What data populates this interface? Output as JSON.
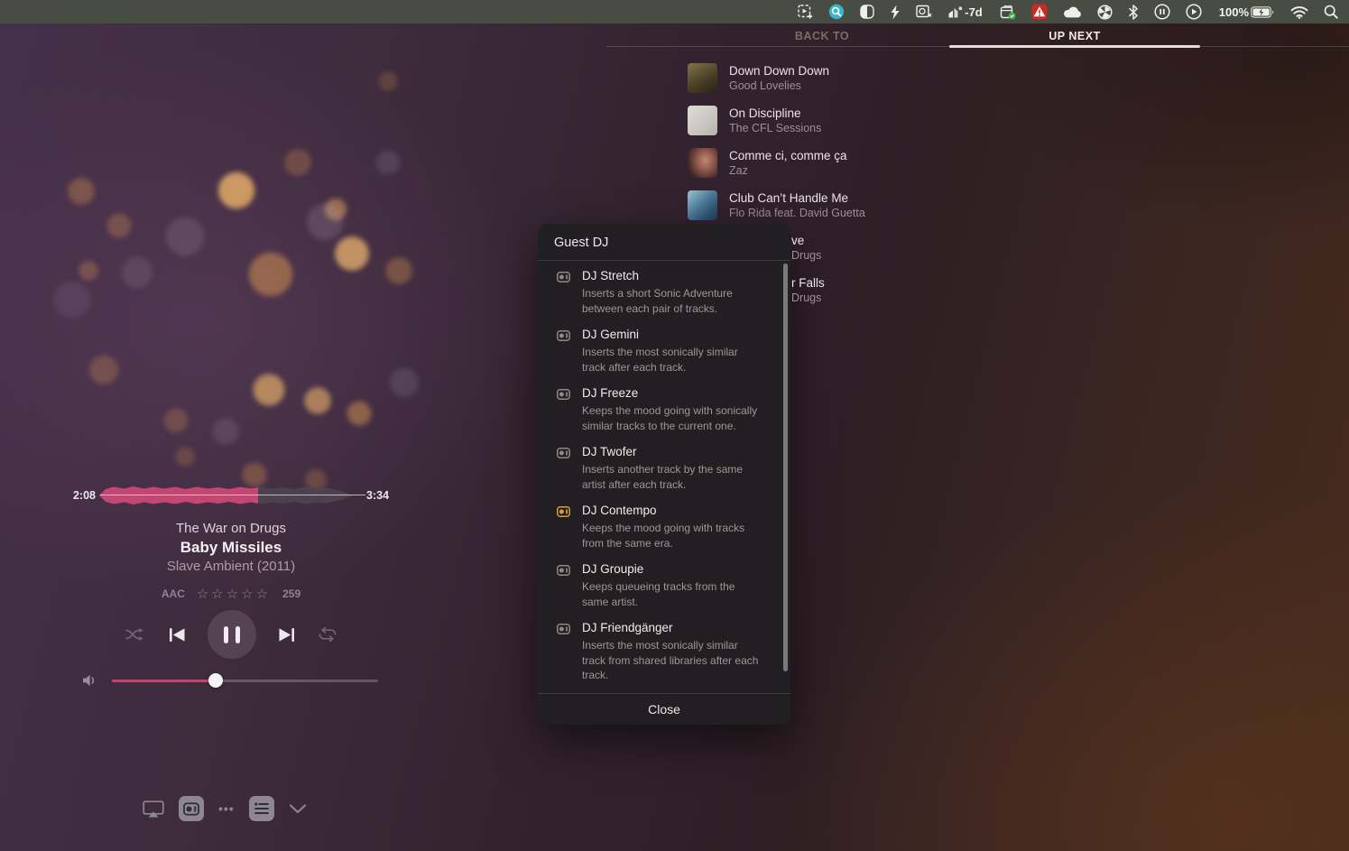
{
  "menu_bar": {
    "bg": "#474d42",
    "items": [
      {
        "name": "screen-capture"
      },
      {
        "name": "search-app"
      },
      {
        "name": "display-contrast"
      },
      {
        "name": "lightning"
      },
      {
        "name": "photo-ocr"
      },
      {
        "name": "data-meter",
        "label": "-7d"
      },
      {
        "name": "package-status"
      },
      {
        "name": "warning-alert"
      },
      {
        "name": "cloud"
      },
      {
        "name": "activity-pie"
      },
      {
        "name": "bluetooth"
      },
      {
        "name": "record-circle"
      },
      {
        "name": "play-circle"
      },
      {
        "name": "battery",
        "label": "100%"
      },
      {
        "name": "wifi"
      },
      {
        "name": "spotlight-search"
      }
    ]
  },
  "tabs": {
    "back_to": "BACK TO",
    "up_next": "UP NEXT",
    "active": "UP NEXT"
  },
  "up_next": {
    "items": [
      {
        "title": "Down Down Down",
        "artist": "Good Lovelies"
      },
      {
        "title": "On Discipline",
        "artist": "The CFL Sessions"
      },
      {
        "title": "Comme ci, comme ça",
        "artist": "Zaz"
      },
      {
        "title": "Club Can’t Handle Me",
        "artist": "Flo Rida feat. David Guetta"
      }
    ],
    "partial_items": [
      {
        "title": "ve",
        "artist": "Drugs"
      },
      {
        "title": "r Falls",
        "artist": "Drugs"
      }
    ]
  },
  "player": {
    "elapsed": "2:08",
    "duration": "3:34",
    "progress_fraction": 0.62,
    "artist": "The War on Drugs",
    "track": "Baby Missiles",
    "album": "Slave Ambient (2011)",
    "format": "AAC",
    "stars": "☆☆☆☆☆",
    "play_count": "259",
    "volume_fraction": 0.39,
    "accent": "#c54672"
  },
  "dialog": {
    "title": "Guest DJ",
    "close_label": "Close",
    "selected_color": "#d9a02f",
    "idle_icon_color": "#8e8a89",
    "items": [
      {
        "name": "DJ Stretch",
        "description": "Inserts a short Sonic Adventure between each pair of tracks.",
        "selected": false
      },
      {
        "name": "DJ Gemini",
        "description": "Inserts the most sonically similar track after each track.",
        "selected": false
      },
      {
        "name": "DJ Freeze",
        "description": "Keeps the mood going with sonically similar tracks to the current one.",
        "selected": false
      },
      {
        "name": "DJ Twofer",
        "description": "Inserts another track by the same artist after each track.",
        "selected": false
      },
      {
        "name": "DJ Contempo",
        "description": "Keeps the mood going with tracks from the same era.",
        "selected": true
      },
      {
        "name": "DJ Groupie",
        "description": "Keeps queueing tracks from the same artist.",
        "selected": false
      },
      {
        "name": "DJ Friendgänger",
        "description": "Inserts the most sonically similar track from shared libraries after each track.",
        "selected": false
      }
    ]
  }
}
